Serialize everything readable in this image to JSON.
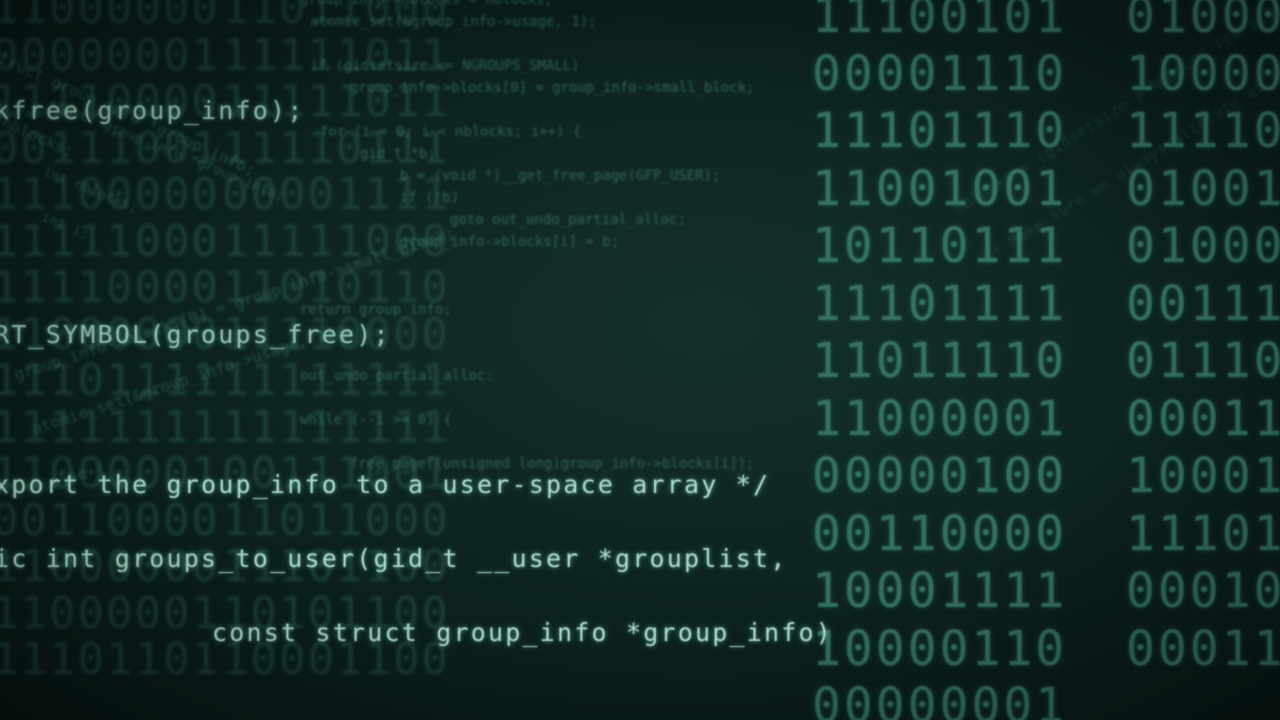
{
  "binary_columns": {
    "right_a": [
      "11100101",
      "00001110",
      "11101110",
      "11001001",
      "10110111",
      "11101111",
      "11011110",
      "11000001",
      "00000100",
      "00110000",
      "10001111",
      "10000110",
      "00000001"
    ],
    "right_b": [
      "01000",
      "10000",
      "11110",
      "01001",
      "01000",
      "00111",
      "01110",
      "00011",
      "10001",
      "11101",
      "00010",
      "00011"
    ],
    "left_a": [
      "11000000",
      "00000001",
      "11110000",
      "00111001",
      "11100000",
      "11111000",
      "11110000",
      "11000000",
      "11101111",
      "11111111",
      "11000001",
      "00110000",
      "11000000",
      "11000001",
      "11101101"
    ],
    "left_b": [
      "11011000",
      "11111011",
      "11111011",
      "11110111",
      "00001111",
      "11111000",
      "11010110",
      "11110000",
      "11111111",
      "11111111",
      "00111001",
      "11011000",
      "11101100",
      "10101100",
      "10001100"
    ]
  },
  "background_code": [
    "group_info->nblocks = nblocks;",
    "atomic_set(&group_info->usage, 1);",
    "if (gidsetsize <= NGROUPS_SMALL)",
    "group_info->blocks[0] = group_info->small_block;",
    "for (i = 0; i < nblocks; i++) {",
    "gid_t *b;",
    "b = (void *)__get_free_page(GFP_USER);",
    "if (!b)",
    "goto out_undo_partial_alloc;",
    "group_info->blocks[i] = b;",
    "return group_info;",
    "out_undo_partial_alloc:",
    "while (--i >= 0) {",
    "free_page((unsigned long)group_info->blocks[i]);",
    "struct group_info *group_info;",
    "int nblocks;",
    "int i;"
  ],
  "streaks": {
    "left_a": [
      "struct group_info *group_info;",
      "int nblocks;",
      "int i;"
    ],
    "left_b": [
      "group_info->blocks[0] = group_info->small_block;",
      "atomic_set(&group_info->usage, 1);",
      "else {"
    ],
    "right": [
      "nblocks = (gidsetsize + NGROUPS_PER_BLOCK - 1) / NGROUPS_PER_BLOCK;",
      "/* Make sure we always allocate at least one indirect block pointer */"
    ]
  },
  "code_lines": [
    "kfree(group_info);",
    "RT_SYMBOL(groups_free);",
    "xport the group_info to a user-space array */",
    "ic int groups_to_user(gid_t __user *grouplist,",
    "const struct group_info *group_info)"
  ]
}
